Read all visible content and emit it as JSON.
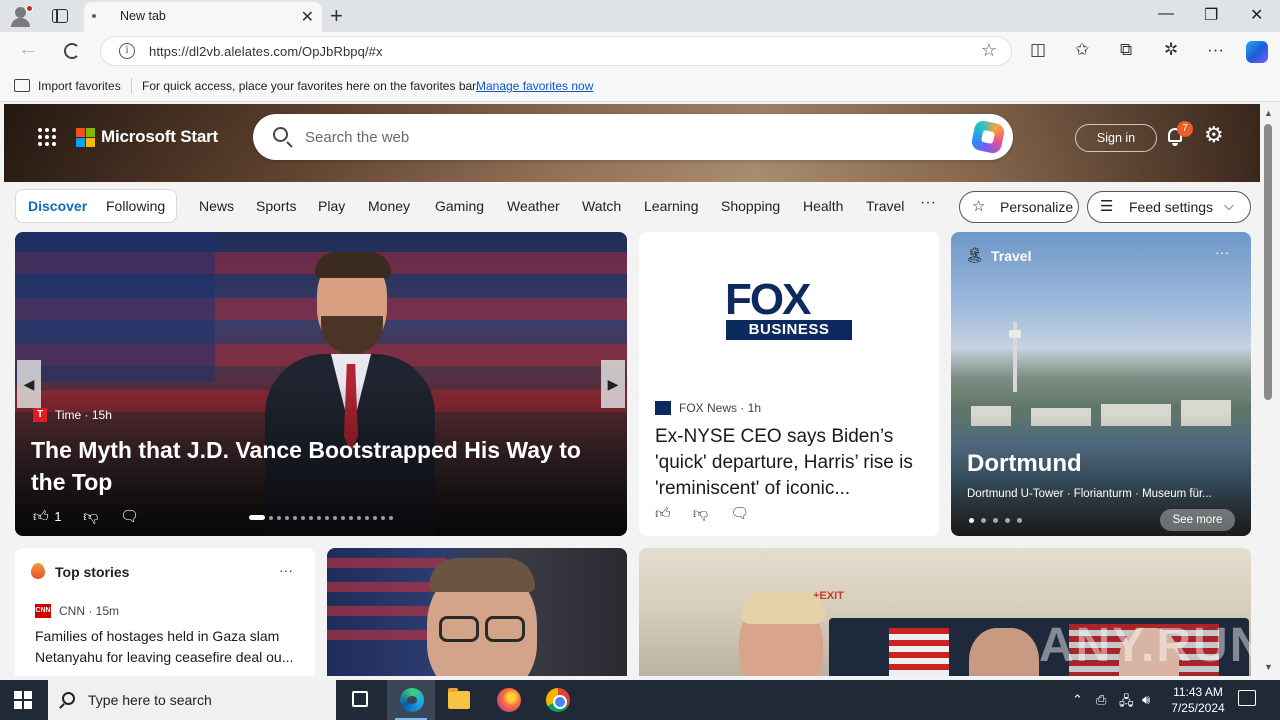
{
  "browser": {
    "tab_title": "New tab",
    "url": "https://dl2vb.alelates.com/OpJbRbpq/#x",
    "favorites_bar": {
      "import_label": "Import favorites",
      "message": "For quick access, place your favorites here on the favorites bar.",
      "link": "Manage favorites now"
    }
  },
  "header": {
    "brand": "Microsoft Start",
    "search_placeholder": "Search the web",
    "sign_in": "Sign in",
    "notification_count": "7"
  },
  "nav": {
    "discover": "Discover",
    "following": "Following",
    "items": [
      "News",
      "Sports",
      "Play",
      "Money",
      "Gaming",
      "Weather",
      "Watch",
      "Learning",
      "Shopping",
      "Health",
      "Travel"
    ],
    "more": "···",
    "personalize": "Personalize",
    "feed_settings": "Feed settings"
  },
  "hero": {
    "source_icon_letter": "T",
    "source": "Time · 15h",
    "title": "The Myth that J.D. Vance Bootstrapped His Way to the Top",
    "likes": "1"
  },
  "fox_card": {
    "logo_top": "FOX",
    "logo_bottom": "BUSINESS",
    "source": "FOX News · 1h",
    "title": "Ex-NYSE CEO says Biden’s 'quick' departure, Harris’ rise is 'reminiscent' of iconic..."
  },
  "travel_card": {
    "category": "Travel",
    "title": "Dortmund",
    "subtitle": "Dortmund U-Tower · Florianturm · Museum für...",
    "see_more": "See more"
  },
  "top_stories": {
    "heading": "Top stories",
    "source_icon_text": "CNN",
    "source": "CNN · 15m",
    "title": "Families of hostages held in Gaza slam Netanyahu for leaving ceasefire deal ou..."
  },
  "trump_card": {
    "exit_sign": "+EXIT",
    "watermark": "ANY.RUN"
  },
  "taskbar": {
    "search_placeholder": "Type here to search",
    "time": "11:43 AM",
    "date": "7/25/2024"
  },
  "colors": {
    "accent": "#0f6cbd",
    "taskbar": "#1f2a36",
    "fox_navy": "#0d2a5e",
    "notification_badge": "#e95d2c"
  }
}
